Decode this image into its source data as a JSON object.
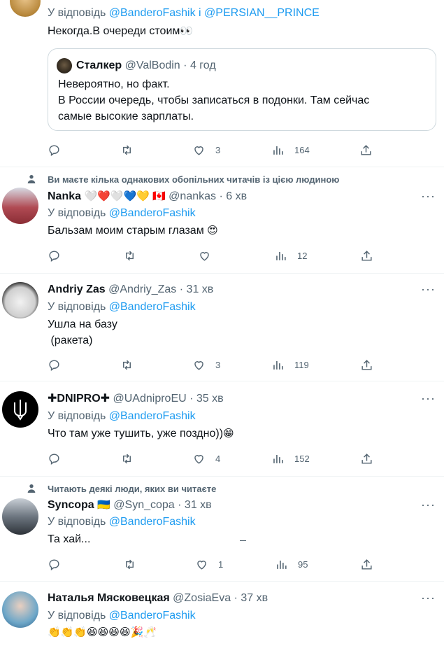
{
  "tweets": [
    {
      "reply_prefix": "У відповідь",
      "reply_to": "@BanderoFashik і @PERSIAN__PRINCE",
      "text": "Некогда.В очереди стоим",
      "text_emoji": "👀",
      "quote": {
        "name": "Сталкер",
        "handle": "@ValBodin",
        "time": "4 год",
        "text_line1": "Невероятно,  но факт.",
        "text_line2": "В России очередь, чтобы записаться в подонки. Там сейчас",
        "text_line3": "самые высокие зарплаты."
      },
      "likes": "3",
      "views": "164"
    },
    {
      "social_context": "Ви маєте кілька однакових обопільних читачів із цією людиною",
      "name": "Nanka",
      "name_emoji": "🤍❤️🤍💙💛 🇨🇦",
      "handle": "@nankas",
      "time": "6 хв",
      "reply_prefix": "У відповідь",
      "reply_to": "@BanderoFashik",
      "text": "Бальзам моим старым глазам",
      "text_emoji": "😍",
      "likes": "",
      "views": "12"
    },
    {
      "name": "Andriy Zas",
      "handle": "@Andriy_Zas",
      "time": "31 хв",
      "reply_prefix": "У відповідь",
      "reply_to": "@BanderoFashik",
      "text_line1": "Ушла на базу",
      "text_line2": " (ракета)",
      "likes": "3",
      "views": "119"
    },
    {
      "name": "✚DNIPRO✚",
      "handle": "@UAdniproEU",
      "time": "35 хв",
      "reply_prefix": "У відповідь",
      "reply_to": "@BanderoFashik",
      "text": "Что там уже тушить, уже поздно))",
      "text_emoji": "😁",
      "likes": "4",
      "views": "152"
    },
    {
      "social_context": "Читають деякі люди, яких ви читаєте",
      "name": "Syncopa",
      "name_emoji": "🇺🇦",
      "handle": "@Syn_copa",
      "time": "31 хв",
      "reply_prefix": "У відповідь",
      "reply_to": "@BanderoFashik",
      "text": "Та хай...",
      "likes": "1",
      "views": "95"
    },
    {
      "name": "Наталья Мясковецкая",
      "handle": "@ZosiaEva",
      "time": "37 хв",
      "reply_prefix": "У відповідь",
      "reply_to": "@BanderoFashik",
      "text_emoji": "👏👏👏😆😆😆😆🎉🥂"
    }
  ],
  "more_glyph": "···",
  "colors": {
    "accent": "#1d9bf0",
    "muted": "#536471",
    "border": "#eff3f4"
  }
}
